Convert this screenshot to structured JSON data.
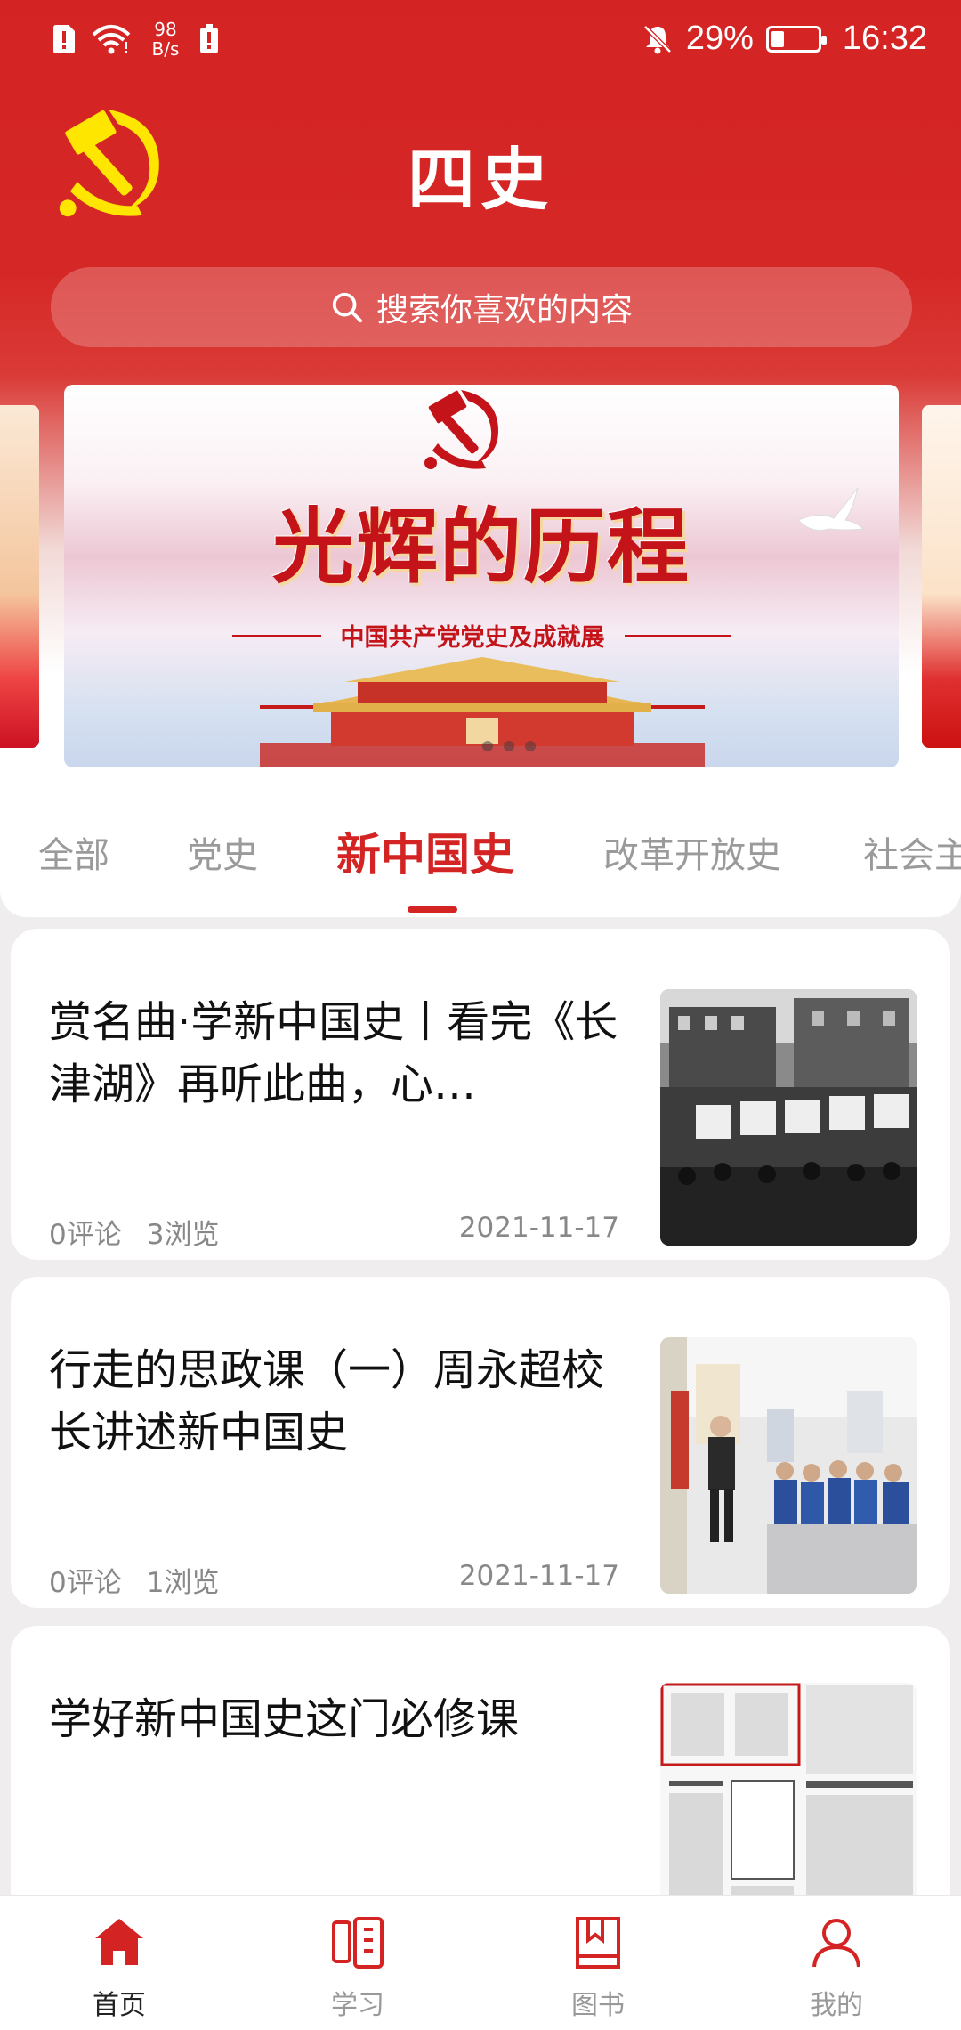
{
  "status_bar": {
    "net_speed_value": "98",
    "net_speed_unit": "B/s",
    "battery_percent": "29%",
    "battery_level": 0.29,
    "time": "16:32"
  },
  "header": {
    "app_title": "四史",
    "search_placeholder": "搜索你喜欢的内容"
  },
  "banner": {
    "title": "光辉的历程",
    "subtitle": "中国共产党党史及成就展",
    "slide_count": 3
  },
  "tabs": [
    {
      "label": "全部",
      "active": false
    },
    {
      "label": "党史",
      "active": false
    },
    {
      "label": "新中国史",
      "active": true
    },
    {
      "label": "改革开放史",
      "active": false
    },
    {
      "label": "社会主",
      "active": false
    }
  ],
  "articles": [
    {
      "title": "赏名曲·学新中国史丨看完《长津湖》再听此曲，心…",
      "comments": "0评论",
      "views": "3浏览",
      "date": "2021-11-17"
    },
    {
      "title": "行走的思政课（一）周永超校长讲述新中国史",
      "comments": "0评论",
      "views": "1浏览",
      "date": "2021-11-17"
    },
    {
      "title": "学好新中国史这门必修课",
      "comments": "",
      "views": "",
      "date": ""
    }
  ],
  "bottom_nav": [
    {
      "label": "首页",
      "icon": "home-icon",
      "active": true
    },
    {
      "label": "学习",
      "icon": "study-icon",
      "active": false
    },
    {
      "label": "图书",
      "icon": "book-icon",
      "active": false
    },
    {
      "label": "我的",
      "icon": "profile-icon",
      "active": false
    }
  ],
  "colors": {
    "brand_red": "#d42323",
    "emblem_yellow": "#ffe600",
    "muted_text": "#888888"
  }
}
